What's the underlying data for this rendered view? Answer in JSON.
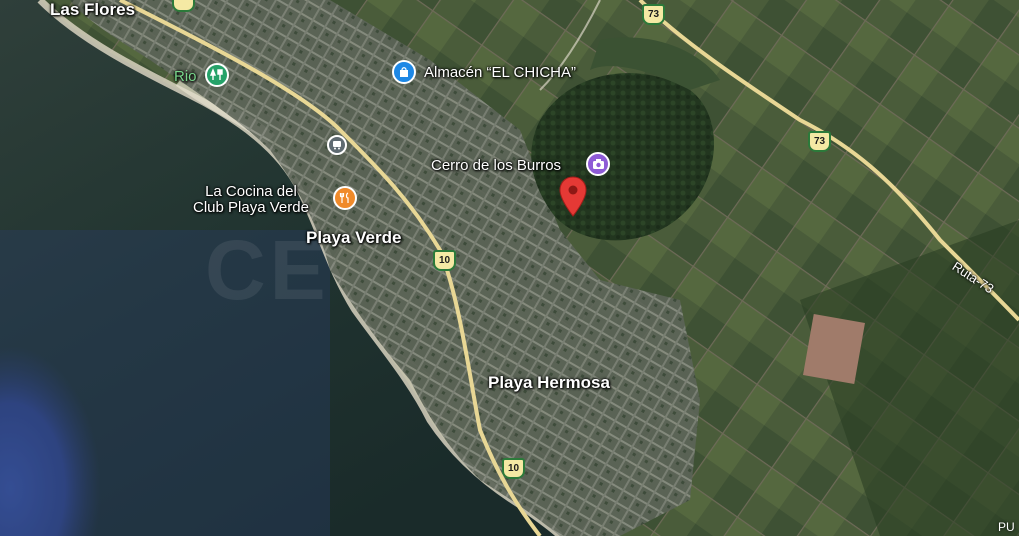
{
  "map": {
    "towns": {
      "las_flores": "Las Flores",
      "playa_verde": "Playa Verde",
      "playa_hermosa": "Playa Hermosa"
    },
    "pois": {
      "almacen": "Almacén “EL CHICHA”",
      "cerro": "Cerro de los Burros",
      "cocina_line1": "La Cocina del",
      "cocina_line2": "Club Playa Verde",
      "rio": "Rio"
    },
    "routes": {
      "r73": "73",
      "r10": "10",
      "ruta73_label": "Ruta-73"
    },
    "edge_text": "PU",
    "watermark": "CE",
    "colors": {
      "pin": "#e53935",
      "poi_blue": "#1e88e5",
      "poi_purple": "#8e5bd6",
      "poi_orange": "#f08a2a",
      "poi_green": "#26a269",
      "road": "#e8d795",
      "shield_border": "#2c7a3a"
    },
    "icons": {
      "almacen": "shopping-bag-icon",
      "cerro": "camera-icon",
      "cocina": "restaurant-icon",
      "rio": "park-icon",
      "bus": "bus-stop-icon",
      "pin": "location-pin-icon"
    }
  }
}
